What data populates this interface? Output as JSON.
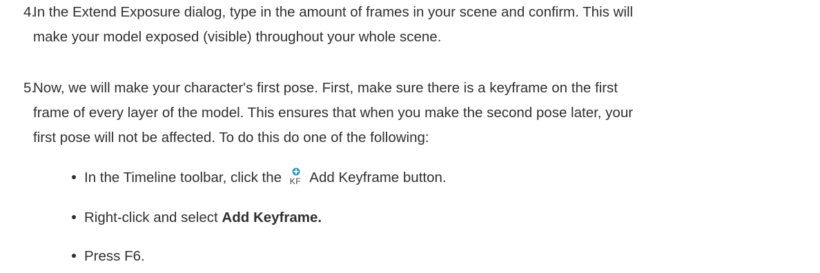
{
  "steps": [
    {
      "number": "4.",
      "lines": [
        "In the Extend Exposure dialog, type in the amount of frames in your scene and confirm. This will",
        "make your model exposed (visible) throughout your whole scene."
      ]
    },
    {
      "number": "5.",
      "lines": [
        "Now, we will make your character's first pose. First, make sure there is a keyframe on the first",
        "frame of every layer of the model. This ensures that when you make the second pose later, your",
        "first pose will not be affected. To do this do one of the following:"
      ]
    }
  ],
  "bullets": [
    {
      "before": "In the Timeline toolbar, click the",
      "icon_name": "add-keyframe-icon",
      "icon_text": "KF",
      "after": "Add Keyframe button."
    },
    {
      "before": "Right-click and select",
      "bold": "Add Keyframe."
    },
    {
      "before": "Press F6."
    }
  ],
  "colors": {
    "text": "#2f2f2f",
    "icon_plus": "#1f9bbd"
  }
}
